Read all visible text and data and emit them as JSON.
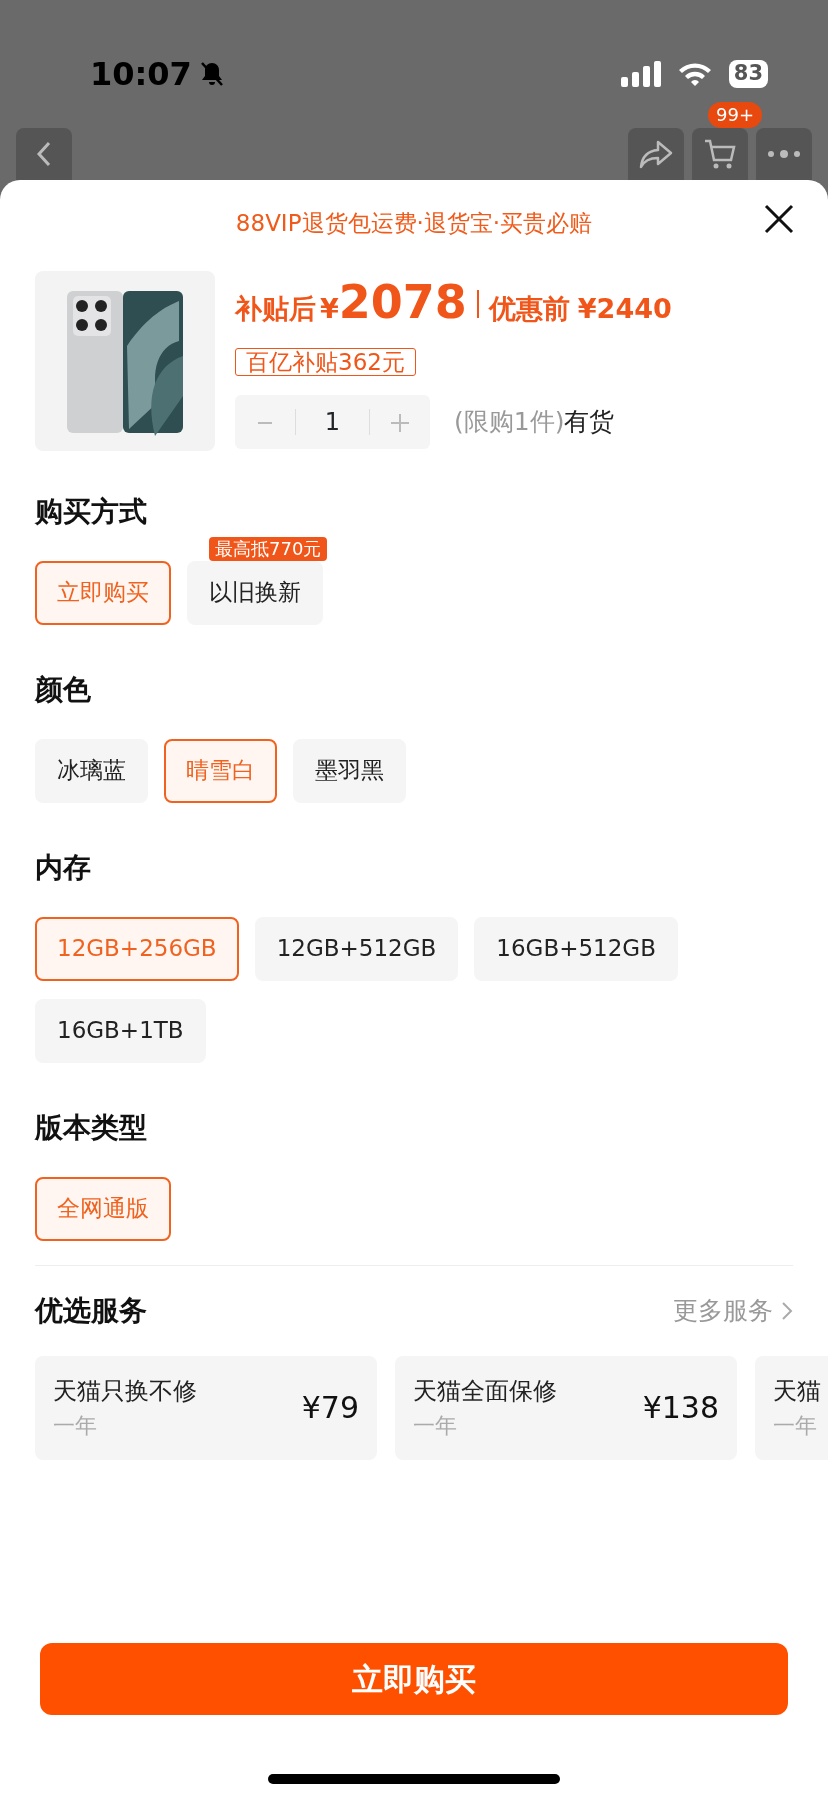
{
  "status_bar": {
    "time": "10:07",
    "battery": "83"
  },
  "nav": {
    "cart_badge": "99+"
  },
  "banner": "88VIP退货包运费·退货宝·买贵必赔",
  "product": {
    "price_label": "补贴后",
    "currency": "¥",
    "price": "2078",
    "original_label": "优惠前",
    "original_price": "¥2440",
    "subsidy_tag": "百亿补贴362元",
    "quantity": "1",
    "limit": "(限购1件)",
    "stock": "有货"
  },
  "options": [
    {
      "title": "购买方式",
      "choices": [
        {
          "label": "立即购买",
          "selected": true
        },
        {
          "label": "以旧换新",
          "selected": false,
          "badge": "最高抵770元"
        }
      ]
    },
    {
      "title": "颜色",
      "choices": [
        {
          "label": "冰璃蓝",
          "selected": false
        },
        {
          "label": "晴雪白",
          "selected": true
        },
        {
          "label": "墨羽黑",
          "selected": false
        }
      ]
    },
    {
      "title": "内存",
      "choices": [
        {
          "label": "12GB+256GB",
          "selected": true
        },
        {
          "label": "12GB+512GB",
          "selected": false
        },
        {
          "label": "16GB+512GB",
          "selected": false
        },
        {
          "label": "16GB+1TB",
          "selected": false
        }
      ]
    },
    {
      "title": "版本类型",
      "choices": [
        {
          "label": "全网通版",
          "selected": true
        }
      ]
    }
  ],
  "services": {
    "title": "优选服务",
    "more": "更多服务",
    "items": [
      {
        "name": "天猫只换不修",
        "term": "一年",
        "price": "¥79"
      },
      {
        "name": "天猫全面保修",
        "term": "一年",
        "price": "¥138"
      },
      {
        "name": "天猫",
        "term": "一年"
      }
    ]
  },
  "buy_button": "立即购买"
}
